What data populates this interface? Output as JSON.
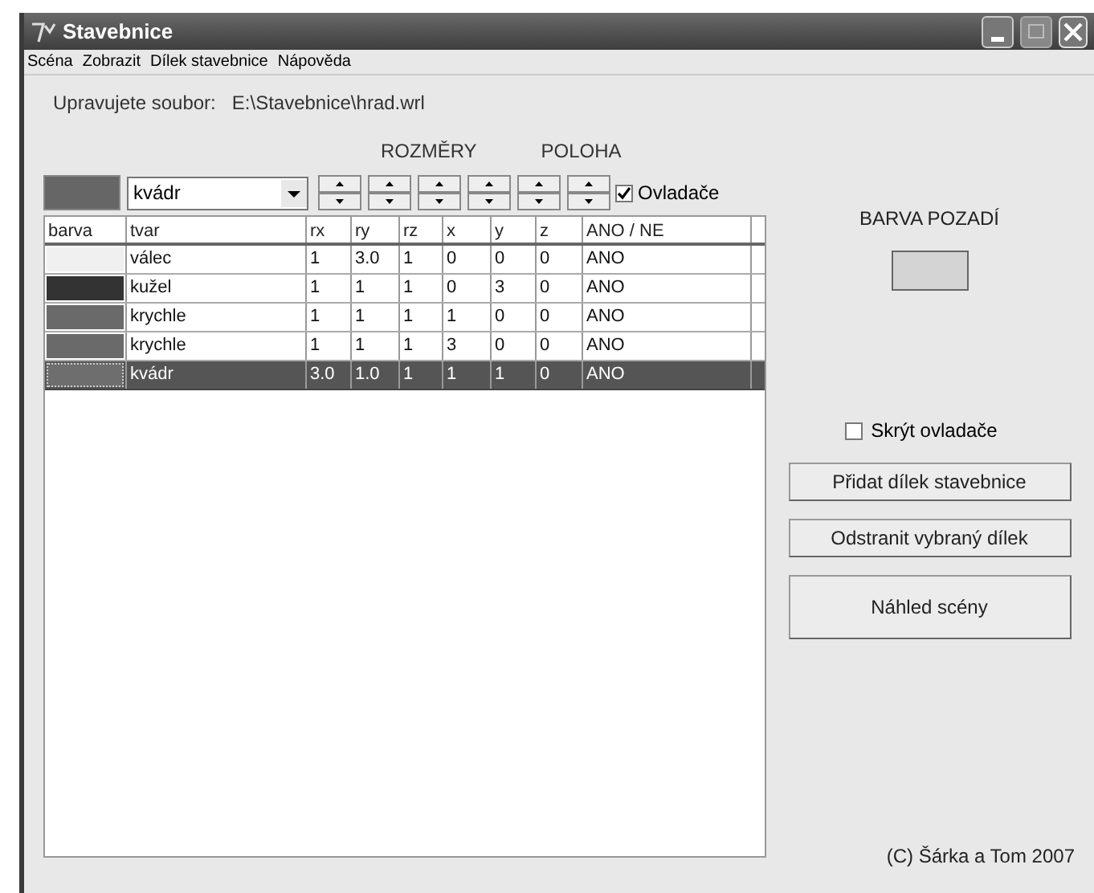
{
  "window": {
    "title": "Stavebnice"
  },
  "menu": [
    "Scéna",
    "Zobrazit",
    "Dílek stavebnice",
    "Nápověda"
  ],
  "file": {
    "label": "Upravujete soubor:",
    "path": "E:\\Stavebnice\\hrad.wrl"
  },
  "group_labels": [
    "ROZMĚRY",
    "POLOHA"
  ],
  "current_color": {
    "color": "#666666"
  },
  "shape_combo": {
    "value": "kvádr"
  },
  "controls_checkbox": {
    "label": "Ovladače",
    "checked": true
  },
  "table": {
    "columns": [
      "barva",
      "tvar",
      "rx",
      "ry",
      "rz",
      "x",
      "y",
      "z",
      "ANO / NE"
    ],
    "rows": [
      {
        "color": "#f0f0f0",
        "cells": [
          "",
          "válec",
          "1",
          "3.0",
          "1",
          "0",
          "0",
          "0",
          "ANO"
        ],
        "selected": false
      },
      {
        "color": "#333333",
        "cells": [
          "",
          "kužel",
          "1",
          "1",
          "1",
          "0",
          "3",
          "0",
          "ANO"
        ],
        "selected": false
      },
      {
        "color": "#6a6a6a",
        "cells": [
          "",
          "krychle",
          "1",
          "1",
          "1",
          "1",
          "0",
          "0",
          "ANO"
        ],
        "selected": false
      },
      {
        "color": "#6a6a6a",
        "cells": [
          "",
          "krychle",
          "1",
          "1",
          "1",
          "3",
          "0",
          "0",
          "ANO"
        ],
        "selected": false
      },
      {
        "color": "#6e6e6e",
        "cells": [
          "",
          "kvádr",
          "3.0",
          "1.0",
          "1",
          "1",
          "1",
          "0",
          "ANO"
        ],
        "selected": true
      }
    ]
  },
  "background": {
    "label": "BARVA POZADÍ",
    "color": "#d4d4d4"
  },
  "hide_checkbox": {
    "label": "Skrýt ovladače",
    "checked": false
  },
  "buttons": [
    "Přidat dílek stavebnice",
    "Odstranit vybraný dílek",
    "Náhled scény"
  ],
  "copyright": "(C) Šárka a Tom 2007"
}
